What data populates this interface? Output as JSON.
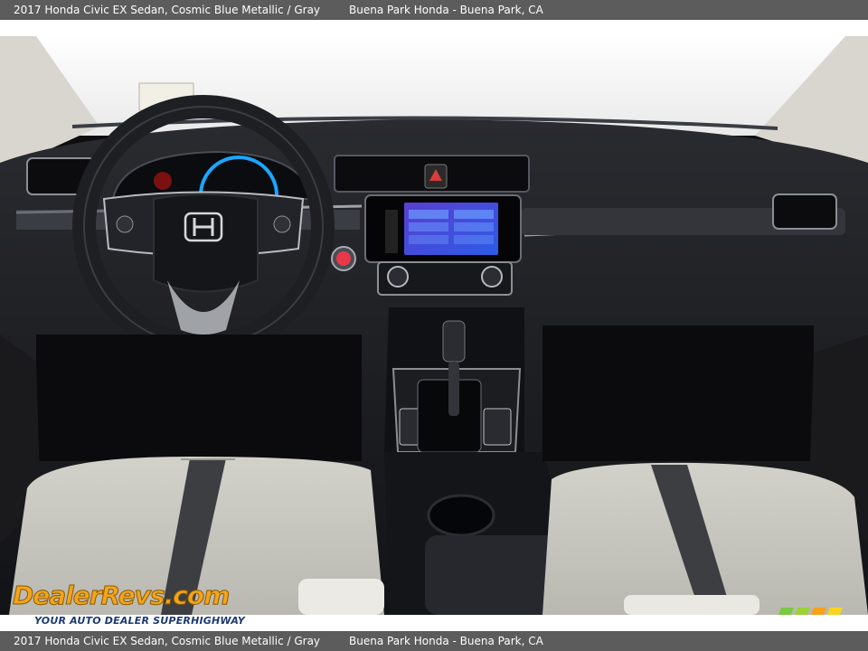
{
  "caption": {
    "vehicle": "2017 Honda Civic EX Sedan,   Cosmic Blue Metallic / Gray",
    "dealer": "Buena Park Honda - Buena Park, CA"
  },
  "watermark": {
    "brand": "DealerRevs.com",
    "tagline": "YOUR AUTO DEALER SUPERHIGHWAY"
  },
  "photo": {
    "subject": "interior-dashboard",
    "colors": {
      "dash": "#1c1d21",
      "seat": "#c9c8c1",
      "trim": "#9fa3a8",
      "screen": "#3a4fd8"
    }
  }
}
